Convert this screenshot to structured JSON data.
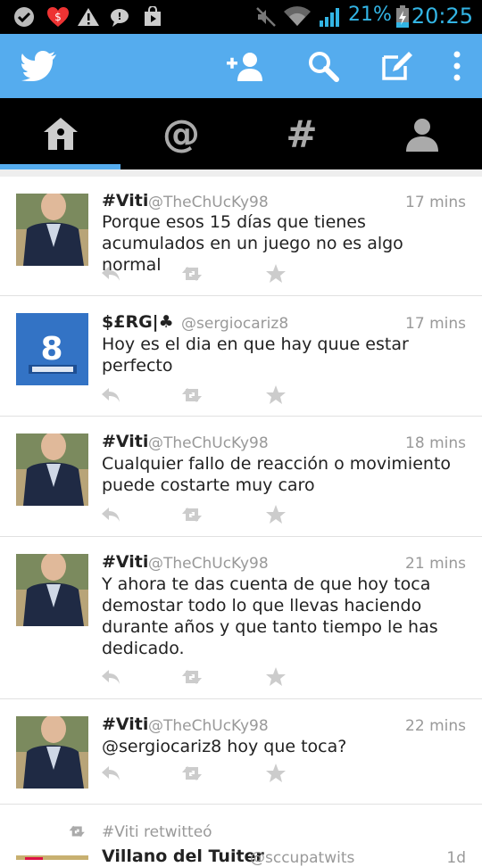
{
  "status_bar": {
    "battery_percent": "21%",
    "time": "20:25",
    "accent_color": "#33b5e5"
  },
  "action_bar": {
    "color": "#55acee",
    "icons": [
      "twitter-bird-icon",
      "add-user-icon",
      "search-icon",
      "compose-icon",
      "overflow-menu-icon"
    ]
  },
  "tabs": [
    {
      "name": "home",
      "icon": "home-icon",
      "active": true
    },
    {
      "name": "mentions",
      "icon": "at-icon",
      "active": false
    },
    {
      "name": "discover",
      "icon": "hashtag-icon",
      "active": false
    },
    {
      "name": "profile",
      "icon": "person-icon",
      "active": false
    }
  ],
  "tweets": [
    {
      "name": "#Viti",
      "handle": "@TheChUcKy98",
      "time": "17 mins",
      "text": "Porque esos 15 días que tienes acumulados en un juego no es algo normal"
    },
    {
      "name": "$£RG|♣",
      "handle": "@sergiocariz8",
      "time": "17 mins",
      "text": "Hoy es el dia en que hay quue estar perfecto"
    },
    {
      "name": "#Viti",
      "handle": "@TheChUcKy98",
      "time": "18 mins",
      "text": "Cualquier fallo de reacción o movimiento puede costarte muy caro"
    },
    {
      "name": "#Viti",
      "handle": "@TheChUcKy98",
      "time": "21 mins",
      "text": "Y ahora te das cuenta de que hoy toca demostar todo lo que llevas haciendo durante años y que tanto tiempo le has dedicado."
    },
    {
      "name": "#Viti",
      "handle": "@TheChUcKy98",
      "time": "22 mins",
      "text": "@sergiocariz8 hoy que toca?"
    }
  ],
  "retweet_item": {
    "retweeted_by": "#Viti retwitteó",
    "name": "Villano del Tuiter",
    "handle": "@sccupatwits",
    "time": "1d"
  }
}
